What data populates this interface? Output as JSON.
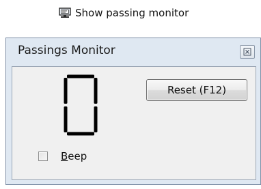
{
  "toolbar": {
    "show_monitor_label": "Show passing monitor",
    "show_monitor_icon": "monitor-icon"
  },
  "window": {
    "title": "Passings Monitor",
    "close_icon": "close-icon",
    "counter": {
      "value": "0",
      "digit_color": "#000000"
    },
    "reset_label": "Reset (F12)",
    "beep": {
      "accelerator": "B",
      "label_rest": "eep",
      "checked": false
    }
  },
  "colors": {
    "frame_bg": "#dfe8f2",
    "frame_border": "#7d8fa6",
    "client_bg": "#f0f0f0"
  }
}
